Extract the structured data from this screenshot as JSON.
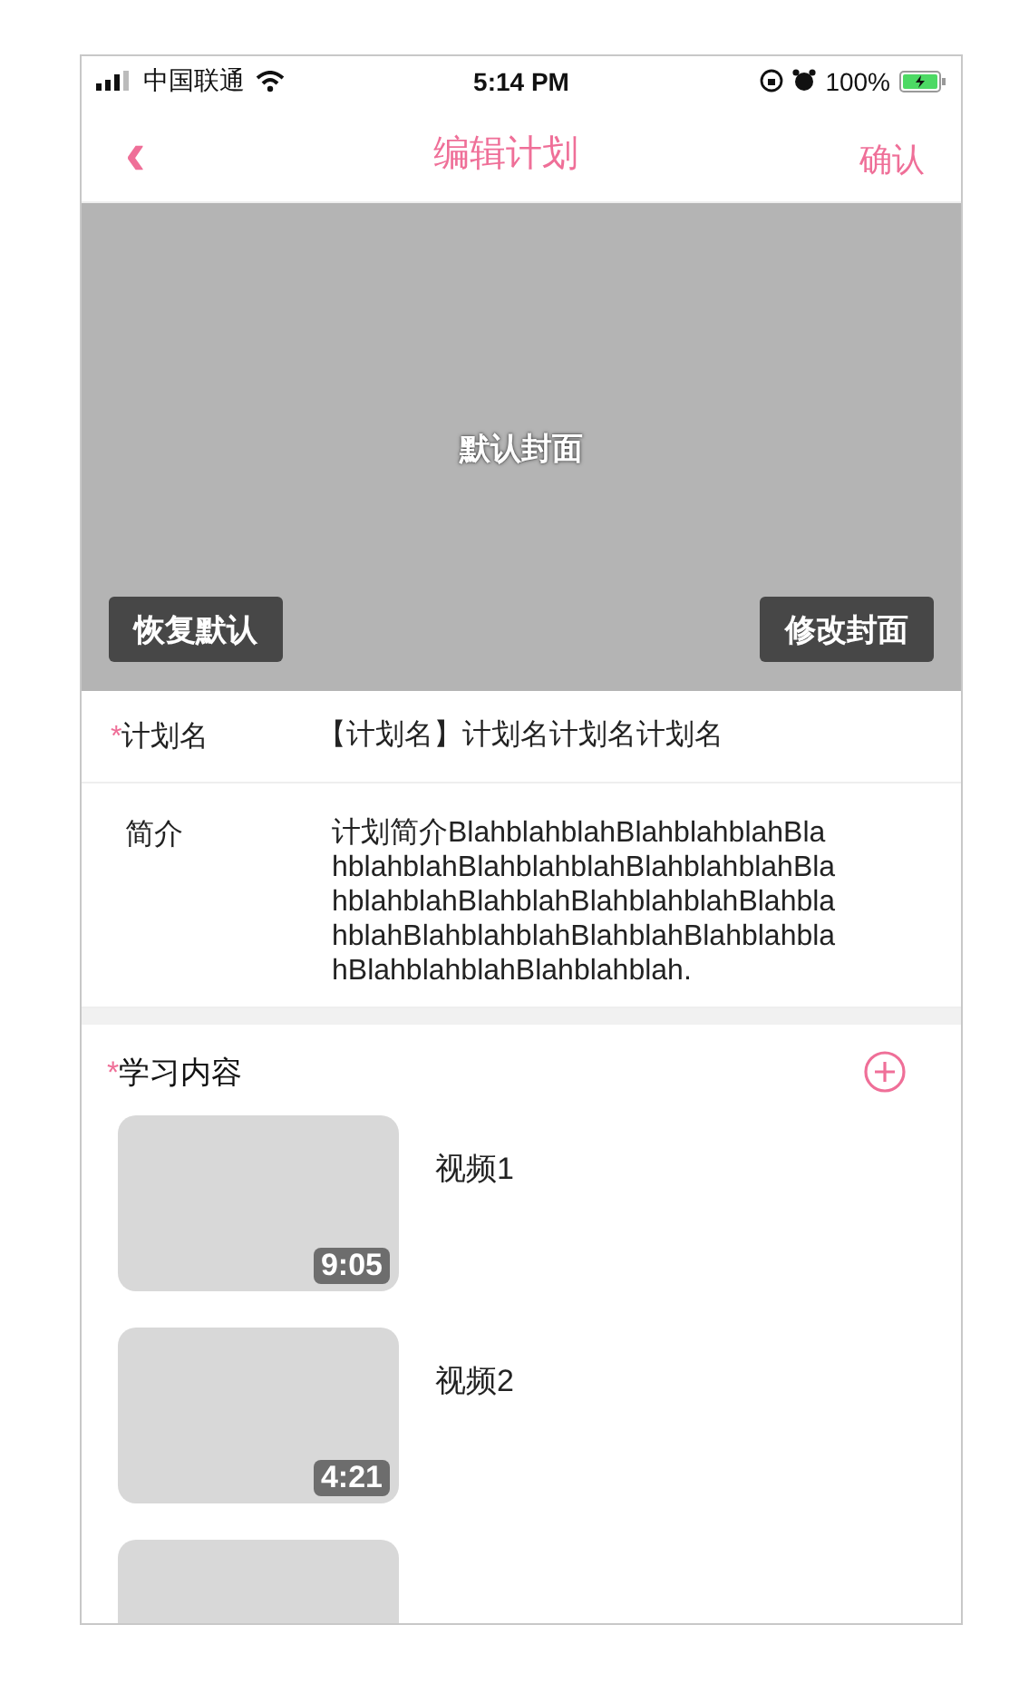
{
  "status_bar": {
    "carrier": "中国联通",
    "time": "5:14 PM",
    "battery": "100%"
  },
  "nav": {
    "back": "‹",
    "title": "编辑计划",
    "confirm": "确认"
  },
  "cover": {
    "label": "默认封面",
    "buttons": [
      {
        "label": "恢复默认"
      },
      {
        "label": "修改封面"
      }
    ]
  },
  "fields": [
    {
      "required_mark": "*",
      "label": "计划名",
      "value": "【计划名】计划名计划名计划名"
    },
    {
      "label": "简介",
      "value": "计划简介BlahblahblahBlahblahblahBlahblahblahBlahblahblahBlahblahblahBlahblahblahBlahblahBlahblahblahBlahblahblahBlahblahblahBlahblahBlahblahblahBlahblahblahBlahblahblah."
    }
  ],
  "content": {
    "required_mark": "*",
    "title": "学习内容",
    "videos": [
      {
        "kind": "video",
        "title": "视频1",
        "duration": "9:05"
      },
      {
        "kind": "video",
        "title": "视频2",
        "duration": "4:21"
      },
      {
        "kind": "cut_off"
      }
    ]
  }
}
